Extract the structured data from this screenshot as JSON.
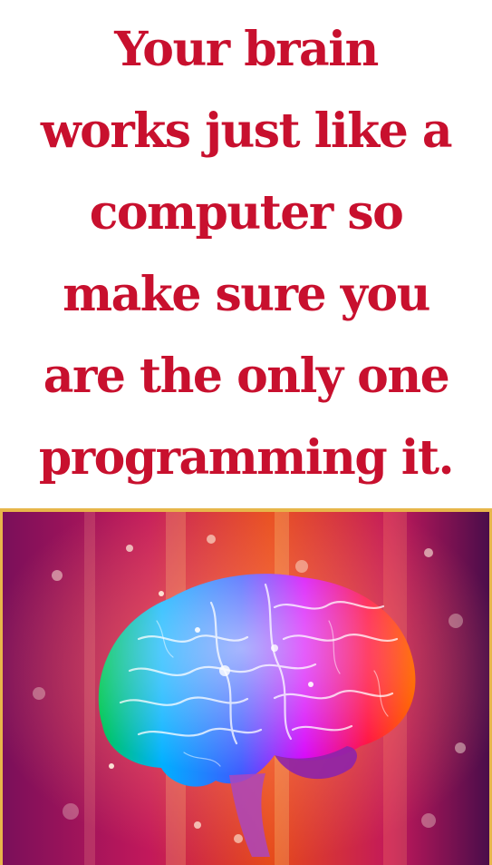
{
  "quote": {
    "lines": [
      "Your brain",
      "works just like a",
      "computer so",
      "make sure you",
      "are the only one",
      "programming it."
    ]
  },
  "colors": {
    "quote_text": "#c8102e",
    "border": "#e7b64a"
  },
  "illustration": {
    "icon": "rainbow-brain-icon"
  }
}
